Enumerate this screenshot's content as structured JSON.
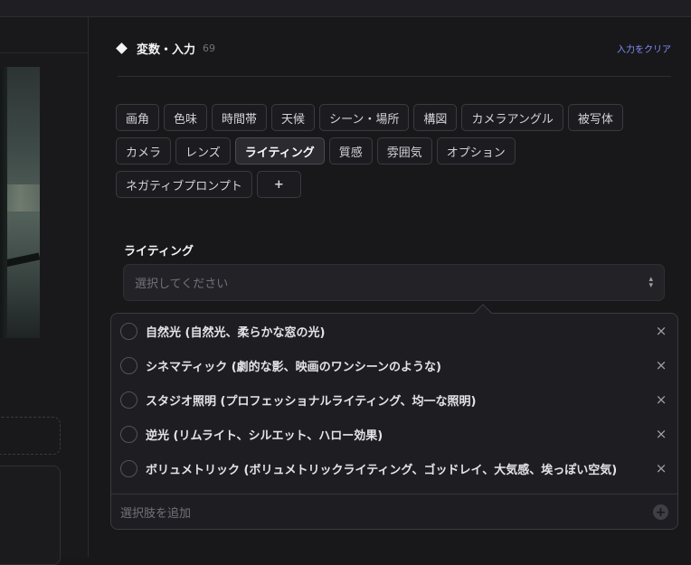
{
  "variables": {
    "title": "変数・入力",
    "count": "69",
    "clear_label": "入力をクリア"
  },
  "tags": {
    "row1": [
      "画角",
      "色味",
      "時間帯",
      "天候",
      "シーン・場所",
      "構図",
      "カメラアングル",
      "被写体"
    ],
    "row2": [
      "カメラ",
      "レンズ",
      "ライティング",
      "質感",
      "雰囲気",
      "オプション"
    ],
    "row3": [
      "ネガティブプロンプト"
    ],
    "add_label": "+",
    "active": "ライティング"
  },
  "field": {
    "label": "ライティング",
    "placeholder": "選択してください"
  },
  "dropdown": {
    "options": [
      "自然光 (自然光、柔らかな窓の光)",
      "シネマティック (劇的な影、映画のワンシーンのような)",
      "スタジオ照明 (プロフェッショナルライティング、均一な照明)",
      "逆光 (リムライト、シルエット、ハロー効果)",
      "ボリュメトリック (ボリュメトリックライティング、ゴッドレイ、大気感、埃っぽい空気)"
    ],
    "remove_symbol": "×",
    "add_placeholder": "選択肢を追加",
    "add_symbol": "+"
  }
}
